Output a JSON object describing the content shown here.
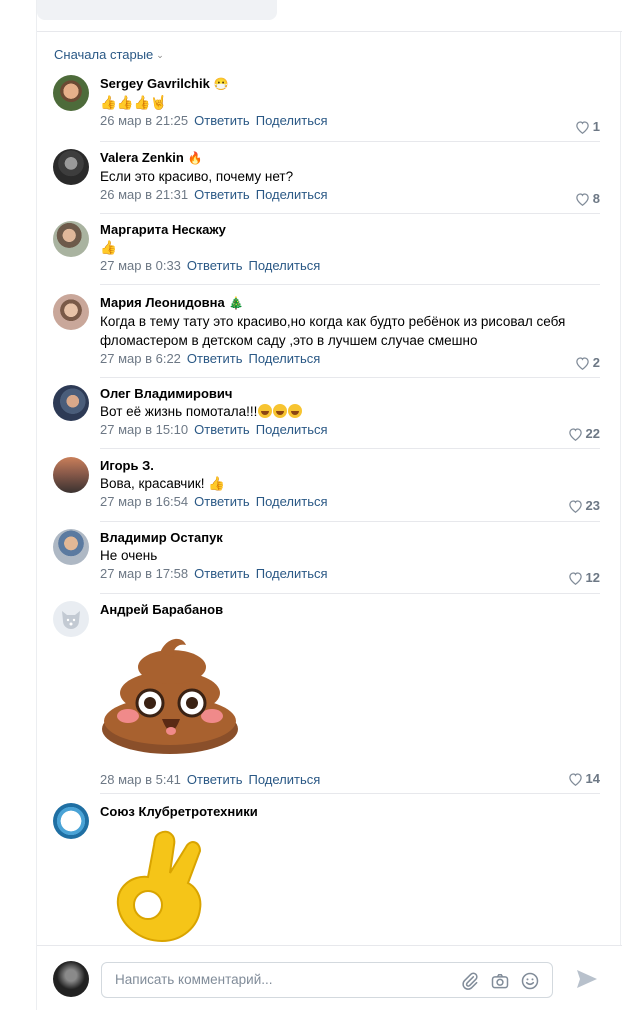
{
  "sort_label": "Сначала старые",
  "share_label": "Поделиться",
  "reply_label": "Ответить",
  "composer": {
    "placeholder": "Написать комментарий..."
  },
  "comments": [
    {
      "author": "Sergey Gavrilchik",
      "text": "",
      "date": "26 мар в 21:25",
      "likes": "1"
    },
    {
      "author": "Valera Zenkin",
      "text": "Если это красиво, почему нет?",
      "date": "26 мар в 21:31",
      "likes": "8"
    },
    {
      "author": "Маргарита Нескажу",
      "text": "",
      "date": "27 мар в 0:33",
      "likes": ""
    },
    {
      "author": "Мария Леонидовна",
      "text": "Когда в тему тату это красиво,но когда как будто ребёнок из рисовал себя фломастером в детском саду ,это в лучшем случае смешно",
      "date": "27 мар в 6:22",
      "likes": "2"
    },
    {
      "author": "Олег Владимирович",
      "text": "Вот её жизнь помотала!!!",
      "date": "27 мар в 15:10",
      "likes": "22"
    },
    {
      "author": "Игорь З.",
      "text": "Вова, красавчик!",
      "date": "27 мар в 16:54",
      "likes": "23"
    },
    {
      "author": "Владимир Остапук",
      "text": "Не очень",
      "date": "27 мар в 17:58",
      "likes": "12"
    },
    {
      "author": "Андрей Барабанов",
      "text": "",
      "date": "28 мар в 5:41",
      "likes": "14"
    },
    {
      "author": "Союз Клубретротехники",
      "text": "",
      "date": "",
      "likes": ""
    }
  ]
}
